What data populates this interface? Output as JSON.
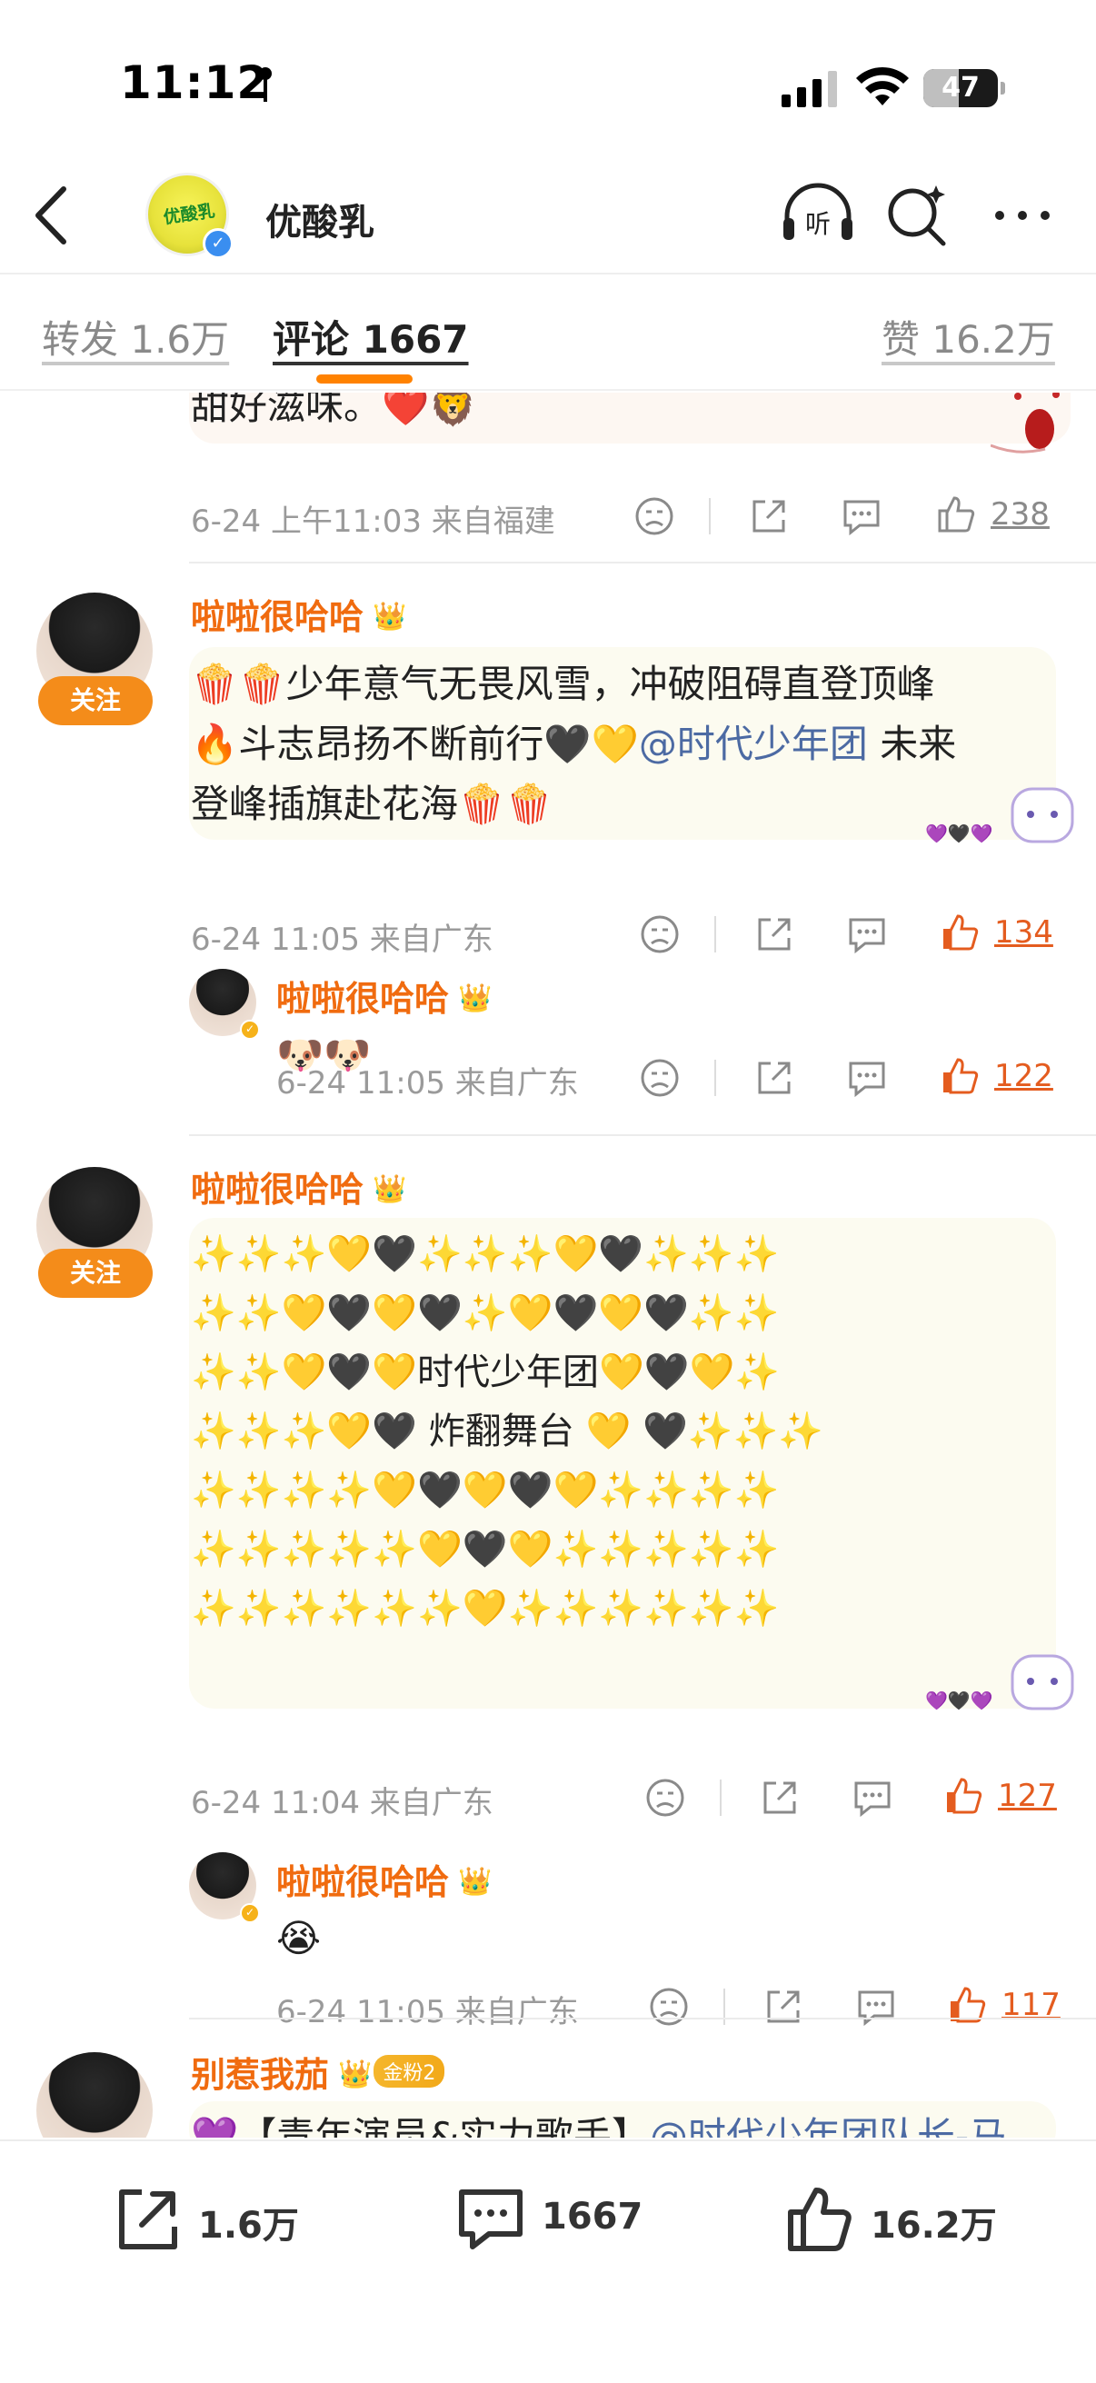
{
  "status": {
    "time": "11:12",
    "battery": "47",
    "battery_level": 0.47
  },
  "nav": {
    "title": "优酸乳",
    "avatar_text": "优酸乳"
  },
  "tabs": [
    {
      "label": "转发 1.6万"
    },
    {
      "label": "评论 1667",
      "active": true
    },
    {
      "label": "赞 16.2万"
    }
  ],
  "comments": [
    {
      "text": "甜好滋味。❤️🦁",
      "meta": "6-24 上午11:03  来自福建",
      "likes": "238"
    },
    {
      "user": "啦啦很哈哈",
      "follow": "关注",
      "text_a": "🍿🍿少年意气无畏风雪，冲破阻碍直登顶峰\n🔥斗志昂扬不断前行🖤💛",
      "mention": "@时代少年团",
      "text_b": " 未来\n登峰插旗赴花海🍿🍿",
      "meta": "6-24 11:05  来自广东",
      "likes": "134",
      "reply": {
        "user": "啦啦很哈哈",
        "text": "🐶🐶",
        "meta": "6-24 11:05  来自广东",
        "likes": "122"
      }
    },
    {
      "user": "啦啦很哈哈",
      "follow": "关注",
      "text": "✨✨✨💛🖤✨✨✨💛🖤✨✨✨\n✨✨💛🖤💛🖤✨💛🖤💛🖤✨✨\n✨✨💛🖤💛时代少年团💛🖤💛✨\n✨✨✨💛🖤 炸翻舞台 💛 🖤✨✨✨\n✨✨✨✨💛🖤💛🖤💛✨✨✨✨\n✨✨✨✨✨💛🖤💛✨✨✨✨✨\n✨✨✨✨✨✨💛✨✨✨✨✨✨",
      "meta": "6-24 11:04  来自广东",
      "likes": "127",
      "reply": {
        "user": "啦啦很哈哈",
        "text": "😭",
        "meta": "6-24 11:05  来自广东",
        "likes": "117"
      }
    },
    {
      "user": "别惹我茄",
      "fan_badge": "金粉2",
      "text_a": "💜【青年演员&实力歌手】",
      "mention": "@时代少年团队长-马"
    }
  ],
  "bottom": {
    "repost": "1.6万",
    "comment": "1667",
    "like": "16.2万"
  },
  "colors": {
    "accent": "#ff8200",
    "username": "#f06b0f",
    "mention": "#4c6aa3",
    "hot_like": "#e45c1f"
  },
  "icons": [
    "back-icon",
    "listen-icon",
    "search-icon",
    "more-icon",
    "dislike-icon",
    "share-icon",
    "comment-icon",
    "like-icon"
  ]
}
